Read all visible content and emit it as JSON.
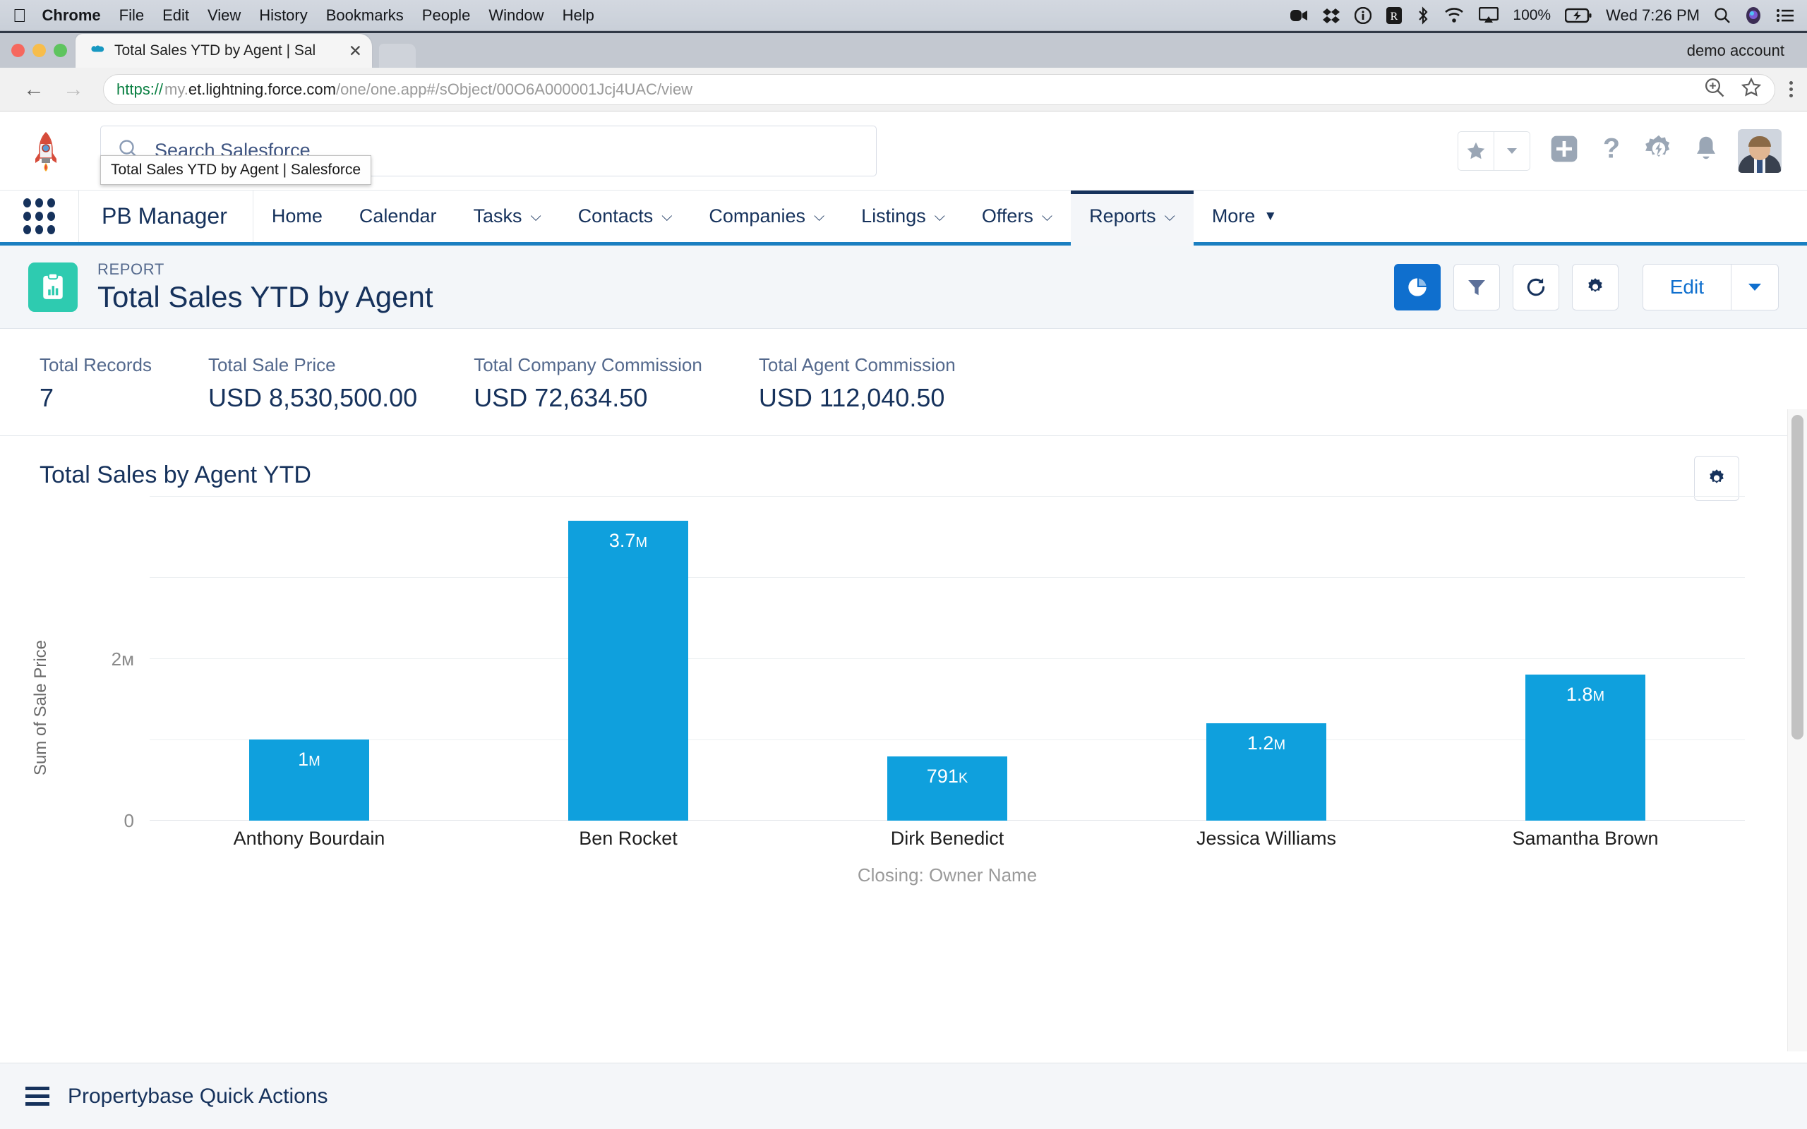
{
  "os_menubar": {
    "apple_icon": "apple-logo-icon",
    "items": [
      "Chrome",
      "File",
      "Edit",
      "View",
      "History",
      "Bookmarks",
      "People",
      "Window",
      "Help"
    ],
    "status_icons": [
      "video-camera-icon",
      "dropbox-icon",
      "info-circle-icon",
      "rx-app-icon",
      "bluetooth-icon",
      "wifi-icon",
      "airplay-icon"
    ],
    "battery_percent": "100%",
    "battery_icon": "battery-charging-icon",
    "clock": "Wed 7:26 PM",
    "spotlight_icon": "search-icon",
    "siri_icon": "siri-icon",
    "notification_center_icon": "list-icon"
  },
  "browser": {
    "tab": {
      "title": "Total Sales YTD by Agent | Sal",
      "favicon": "salesforce-cloud-icon",
      "close_icon": "close-icon"
    },
    "new_tab_label": "+",
    "profile_label": "demo account",
    "tooltip": "Total Sales YTD by Agent | Salesforce",
    "back_icon": "arrow-left-icon",
    "forward_icon": "arrow-right-icon",
    "url": {
      "scheme": "https://",
      "host_dim": "my.",
      "host": "et.lightning.force.com",
      "path": "/one/one.app#/sObject/00O6A000001Jcj4UAC/view"
    },
    "omni_icons": [
      "zoom-in-icon",
      "bookmark-star-icon",
      "chrome-menu-icon"
    ]
  },
  "salesforce": {
    "logo_icon": "rocket-logo-icon",
    "search": {
      "placeholder": "Search Salesforce",
      "icon": "search-icon"
    },
    "header_icons": [
      "favorites-star-icon",
      "favorites-dropdown-icon",
      "global-create-icon",
      "help-icon",
      "setup-gear-icon",
      "notifications-bell-icon",
      "avatar"
    ],
    "app_launcher_icon": "app-launcher-icon",
    "app_name": "PB Manager",
    "nav": [
      {
        "label": "Home",
        "has_dropdown": false,
        "active": false
      },
      {
        "label": "Calendar",
        "has_dropdown": false,
        "active": false
      },
      {
        "label": "Tasks",
        "has_dropdown": true,
        "active": false
      },
      {
        "label": "Contacts",
        "has_dropdown": true,
        "active": false
      },
      {
        "label": "Companies",
        "has_dropdown": true,
        "active": false
      },
      {
        "label": "Listings",
        "has_dropdown": true,
        "active": false
      },
      {
        "label": "Offers",
        "has_dropdown": true,
        "active": false
      },
      {
        "label": "Reports",
        "has_dropdown": true,
        "active": true
      },
      {
        "label": "More",
        "has_dropdown": true,
        "active": false
      }
    ]
  },
  "report": {
    "icon": "report-clipboard-icon",
    "kicker": "REPORT",
    "title": "Total Sales YTD by Agent",
    "buttons": [
      {
        "name": "chart-toggle-button",
        "icon": "pie-chart-icon",
        "active": true
      },
      {
        "name": "filter-button",
        "icon": "filter-funnel-icon",
        "active": false
      },
      {
        "name": "refresh-button",
        "icon": "refresh-icon",
        "active": false
      },
      {
        "name": "report-settings-button",
        "icon": "gear-icon",
        "active": false
      }
    ],
    "edit_label": "Edit",
    "edit_caret_icon": "caret-down-icon"
  },
  "metrics": [
    {
      "label": "Total Records",
      "value": "7"
    },
    {
      "label": "Total Sale Price",
      "value": "USD 8,530,500.00"
    },
    {
      "label": "Total Company Commission",
      "value": "USD 72,634.50"
    },
    {
      "label": "Total Agent Commission",
      "value": "USD 112,040.50"
    }
  ],
  "chart_panel": {
    "settings_icon": "gear-icon"
  },
  "footer": {
    "icon": "hamburger-icon",
    "label": "Propertybase Quick Actions"
  },
  "chart_data": {
    "type": "bar",
    "title": "Total Sales by Agent YTD",
    "xlabel": "Closing: Owner Name",
    "ylabel": "Sum of Sale Price",
    "categories": [
      "Anthony Bourdain",
      "Ben Rocket",
      "Dirk Benedict",
      "Jessica Williams",
      "Samantha Brown"
    ],
    "values": [
      1000000,
      3700000,
      791000,
      1200000,
      1800000
    ],
    "value_labels": [
      "1м",
      "3.7м",
      "791к",
      "1.2м",
      "1.8м"
    ],
    "value_label_numbers": [
      "1",
      "3.7",
      "791",
      "1.2",
      "1.8"
    ],
    "value_label_suffixes": [
      "M",
      "M",
      "K",
      "M",
      "M"
    ],
    "ylim": [
      0,
      4000000
    ],
    "yticks": [
      0,
      2000000
    ],
    "ytick_labels": [
      "0",
      "2м"
    ],
    "gridlines": [
      0,
      1000000,
      2000000,
      3000000
    ],
    "bar_color": "#0fa0dd",
    "grid": true,
    "legend": "none"
  }
}
